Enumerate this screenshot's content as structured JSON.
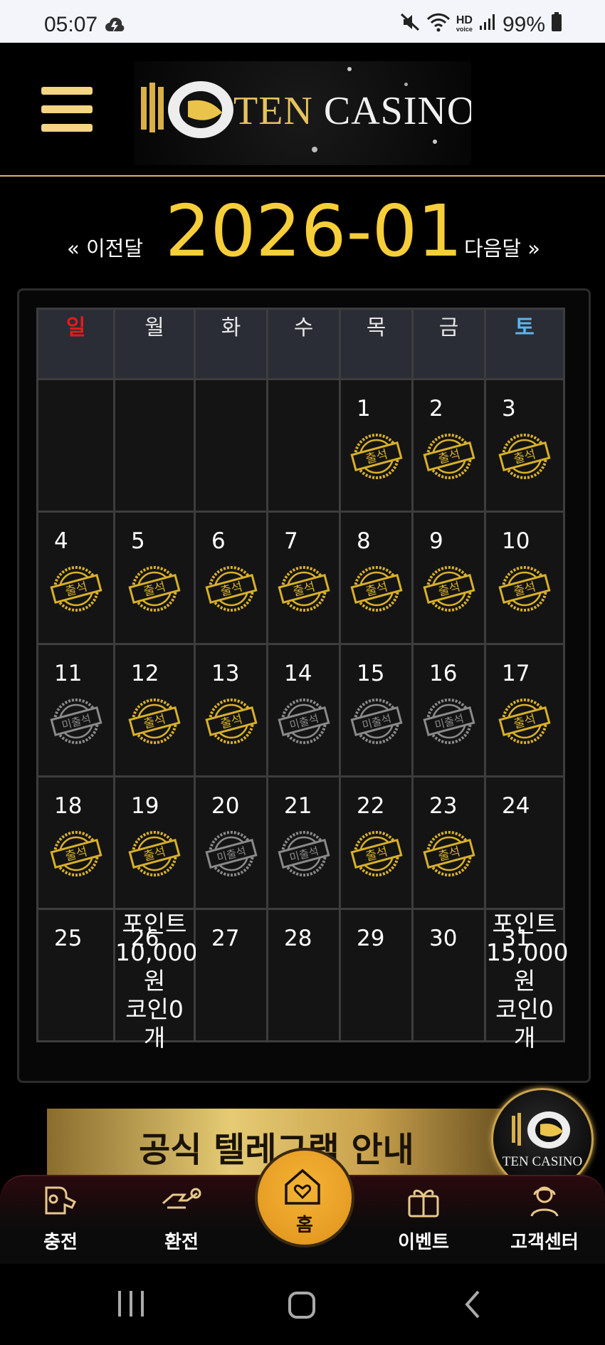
{
  "status_bar": {
    "time": "05:07",
    "hd_label": "HD",
    "volte_label": "voice",
    "battery": "99%"
  },
  "header": {
    "logo_text_1": "TEN",
    "logo_text_2": "CASINO",
    "menu_icon": "hamburger-icon"
  },
  "calendar_nav": {
    "prev_label": "« 이전달",
    "month_title": "2026-01",
    "next_label": "다음달 »"
  },
  "calendar": {
    "weekdays": [
      "일",
      "월",
      "화",
      "수",
      "목",
      "금",
      "토"
    ],
    "stamp_attended": "출석",
    "stamp_missed": "미출석",
    "weeks": [
      [
        {
          "day": ""
        },
        {
          "day": ""
        },
        {
          "day": ""
        },
        {
          "day": ""
        },
        {
          "day": "1",
          "status": "attended"
        },
        {
          "day": "2",
          "status": "attended"
        },
        {
          "day": "3",
          "status": "attended"
        }
      ],
      [
        {
          "day": "4",
          "status": "attended"
        },
        {
          "day": "5",
          "status": "attended"
        },
        {
          "day": "6",
          "status": "attended"
        },
        {
          "day": "7",
          "status": "attended"
        },
        {
          "day": "8",
          "status": "attended"
        },
        {
          "day": "9",
          "status": "attended"
        },
        {
          "day": "10",
          "status": "attended"
        }
      ],
      [
        {
          "day": "11",
          "status": "missed"
        },
        {
          "day": "12",
          "status": "attended"
        },
        {
          "day": "13",
          "status": "attended"
        },
        {
          "day": "14",
          "status": "missed"
        },
        {
          "day": "15",
          "status": "missed"
        },
        {
          "day": "16",
          "status": "missed"
        },
        {
          "day": "17",
          "status": "attended"
        }
      ],
      [
        {
          "day": "18",
          "status": "attended"
        },
        {
          "day": "19",
          "status": "attended"
        },
        {
          "day": "20",
          "status": "missed"
        },
        {
          "day": "21",
          "status": "missed"
        },
        {
          "day": "22",
          "status": "attended"
        },
        {
          "day": "23",
          "status": "attended"
        },
        {
          "day": "24"
        }
      ],
      [
        {
          "day": "25"
        },
        {
          "day": "26",
          "reward": [
            "포인트",
            "10,000",
            "원",
            "코인0",
            "개"
          ]
        },
        {
          "day": "27"
        },
        {
          "day": "28"
        },
        {
          "day": "29"
        },
        {
          "day": "30"
        },
        {
          "day": "31",
          "reward": [
            "포인트",
            "15,000",
            "원",
            "코인0",
            "개"
          ]
        }
      ]
    ]
  },
  "banner": {
    "text": "공식 텔레그램 안내"
  },
  "float_badge": {
    "text": "TEN CASINO"
  },
  "bottom_nav": {
    "deposit": "충전",
    "withdraw": "환전",
    "home": "홈",
    "event": "이벤트",
    "support": "고객센터"
  },
  "colors": {
    "gold": "#f6ce3a",
    "sunday": "#e41b1b",
    "saturday": "#5ab6f0",
    "stamp_gold": "#d8b028",
    "stamp_gray": "#8a8a8a"
  }
}
